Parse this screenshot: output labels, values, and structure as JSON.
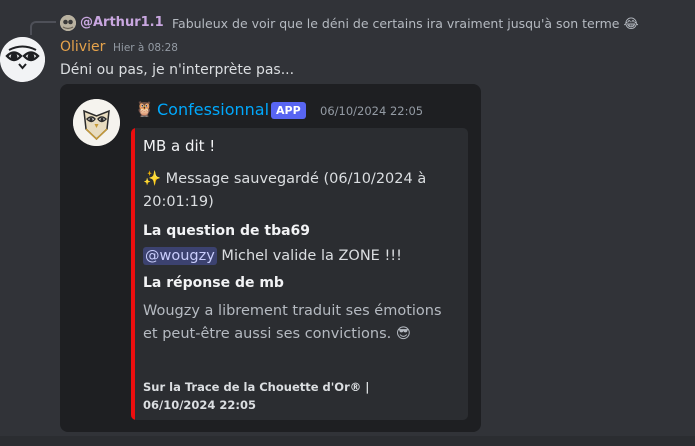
{
  "reply": {
    "author": "@Arthur1.1",
    "text": "Fabuleux de voir que le déni de certains ira vraiment jusqu'à son terme",
    "emoji": "😂"
  },
  "message": {
    "author": "Olivier",
    "timestamp": "Hier à 08:28",
    "content": "Déni ou pas, je n'interprète pas..."
  },
  "embed": {
    "bot_icon": "🦉",
    "bot_name": "Confessionnal",
    "badge": "APP",
    "time": "06/10/2024 22:05",
    "title": "MB a dit !",
    "description": "✨ Message sauvegardé (06/10/2024 à 20:01:19)",
    "question_title": "La question de tba69",
    "question_mention": "@wougzy",
    "question_text": " Michel valide la ZONE !!!",
    "response_title": "La réponse de mb",
    "response_text": "Wougzy a librement traduit ses émotions et peut-être aussi ses convictions. 😎",
    "footer": "Sur la Trace de la Chouette d'Or® | 06/10/2024 22:05",
    "accent_color": "#ed0e0e"
  },
  "colors": {
    "author": "#e6a34b",
    "bot_name": "#00a8fc",
    "badge": "#5865f2",
    "background": "#313338"
  }
}
